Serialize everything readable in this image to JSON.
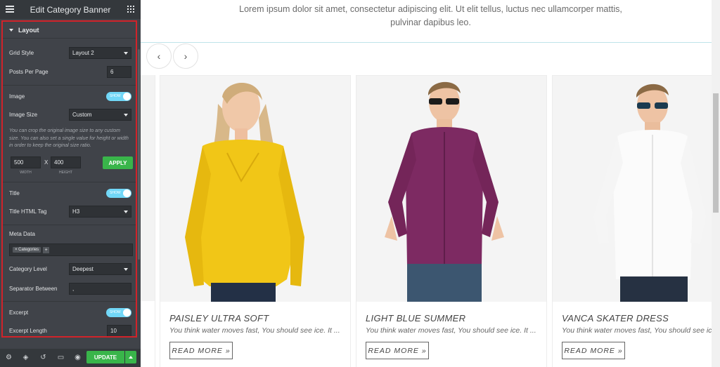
{
  "sidebar": {
    "title": "Edit Category Banner",
    "section": "Layout",
    "grid_style": {
      "label": "Grid Style",
      "value": "Layout 2"
    },
    "posts_per_page": {
      "label": "Posts Per Page",
      "value": "6"
    },
    "image": {
      "label": "Image",
      "toggle": "SHOW"
    },
    "image_size": {
      "label": "Image Size",
      "value": "Custom"
    },
    "image_note": "You can crop the original image size to any custom size. You can also set a single value for height or width in order to keep the original size ratio.",
    "width": {
      "value": "500",
      "caption": "WIDTH"
    },
    "times": "X",
    "height": {
      "value": "400",
      "caption": "HEIGHT"
    },
    "apply": "APPLY",
    "title_toggle": {
      "label": "Title",
      "toggle": "SHOW"
    },
    "title_tag": {
      "label": "Title HTML Tag",
      "value": "H3"
    },
    "meta_data": {
      "label": "Meta Data",
      "tag": "× Categories",
      "add": "+"
    },
    "category_level": {
      "label": "Category Level",
      "value": "Deepest"
    },
    "separator": {
      "label": "Separator Between",
      "value": ","
    },
    "excerpt": {
      "label": "Excerpt",
      "toggle": "SHOW"
    },
    "excerpt_length": {
      "label": "Excerpt Length",
      "value": "10"
    },
    "update": "UPDATE"
  },
  "canvas": {
    "intro": "Lorem ipsum dolor sit amet, consectetur adipiscing elit. Ut elit tellus, luctus nec ullamcorper mattis, pulvinar dapibus leo.",
    "prev": "‹",
    "next": "›",
    "cards": [
      {
        "title": "PAISLEY ULTRA SOFT",
        "excerpt": "You think water moves fast, You should see ice. It ...",
        "cta": "READ MORE »"
      },
      {
        "title": "LIGHT BLUE SUMMER",
        "excerpt": "You think water moves fast, You should see ice. It ...",
        "cta": "READ MORE »"
      },
      {
        "title": "VANCA SKATER DRESS",
        "excerpt": "You think water moves fast, You should see ice. It ...",
        "cta": "READ MORE »"
      }
    ]
  },
  "colors": {
    "sidebar_bg": "#404349",
    "accent_green": "#39b54a",
    "toggle_blue": "#71d7f7",
    "highlight_red": "#d1232a"
  }
}
